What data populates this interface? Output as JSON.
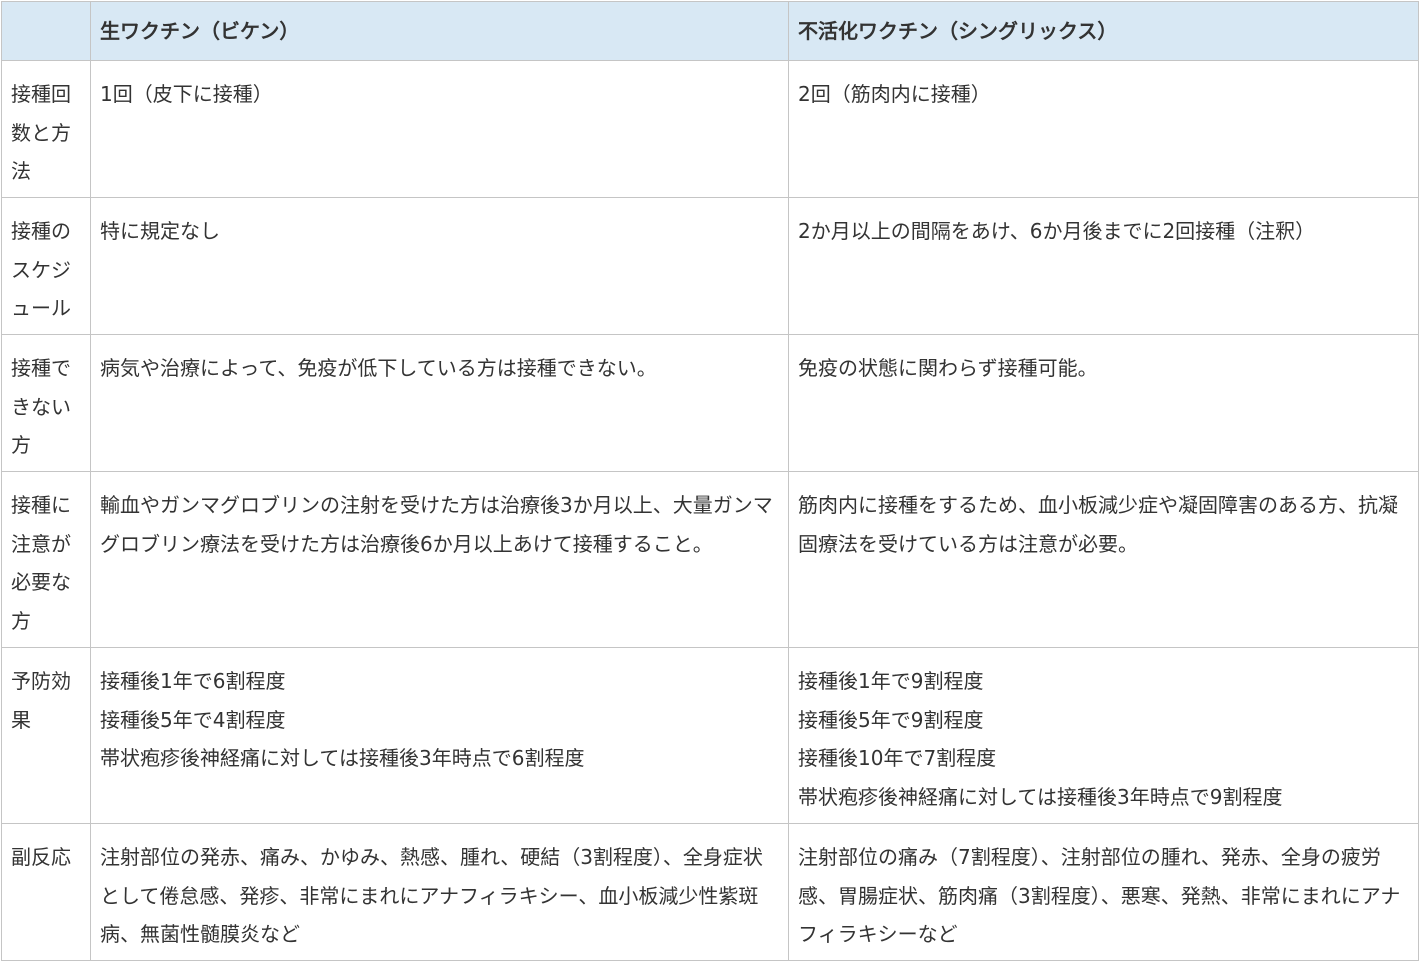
{
  "header": {
    "blank": "",
    "live": "生ワクチン（ビケン）",
    "inactivated": "不活化ワクチン（シングリックス）"
  },
  "rows": [
    {
      "label": "接種回数と方法",
      "live": [
        "1回（皮下に接種）"
      ],
      "inactivated": [
        "2回（筋肉内に接種）"
      ]
    },
    {
      "label": "接種のスケジュール",
      "live": [
        "特に規定なし"
      ],
      "inactivated": [
        "2か月以上の間隔をあけ、6か月後までに2回接種（注釈）"
      ]
    },
    {
      "label": "接種できない方",
      "live": [
        "病気や治療によって、免疫が低下している方は接種できない。"
      ],
      "inactivated": [
        "免疫の状態に関わらず接種可能。"
      ]
    },
    {
      "label": "接種に注意が必要な方",
      "live": [
        "輸血やガンマグロブリンの注射を受けた方は治療後3か月以上、大量ガンマグロブリン療法を受けた方は治療後6か月以上あけて接種すること。"
      ],
      "inactivated": [
        "筋肉内に接種をするため、血小板減少症や凝固障害のある方、抗凝固療法を受けている方は注意が必要。"
      ]
    },
    {
      "label": "予防効果",
      "live": [
        "接種後1年で6割程度",
        "接種後5年で4割程度",
        "帯状疱疹後神経痛に対しては接種後3年時点で6割程度"
      ],
      "inactivated": [
        "接種後1年で9割程度",
        "接種後5年で9割程度",
        "接種後10年で7割程度",
        "帯状疱疹後神経痛に対しては接種後3年時点で9割程度"
      ]
    },
    {
      "label": "副反応",
      "live": [
        "注射部位の発赤、痛み、かゆみ、熱感、腫れ、硬結（3割程度）、全身症状として倦怠感、発疹、非常にまれにアナフィラキシー、血小板減少性紫斑病、無菌性髄膜炎など"
      ],
      "inactivated": [
        "注射部位の痛み（7割程度）、注射部位の腫れ、発赤、全身の疲労感、胃腸症状、筋肉痛（3割程度）、悪寒、発熱、非常にまれにアナフィラキシーなど"
      ]
    }
  ]
}
